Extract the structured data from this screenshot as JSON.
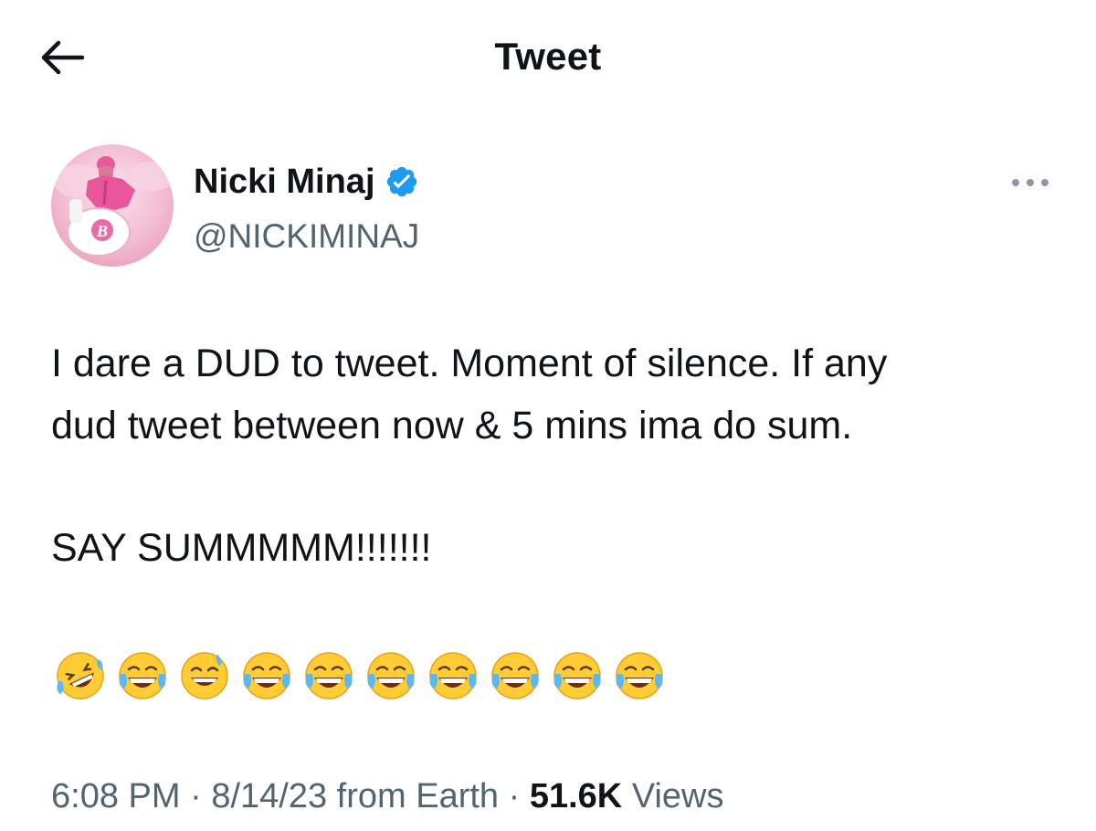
{
  "header": {
    "title": "Tweet"
  },
  "tweet": {
    "author": {
      "display_name": "Nicki Minaj",
      "handle": "@NICKIMINAJ",
      "verified": true
    },
    "text_line_1": "I dare a DUD to tweet. Moment of silence. If any",
    "text_line_2": "dud tweet between now & 5 mins ima do sum.",
    "text_line_3": "SAY SUMMMMM!!!!!!!",
    "emojis": [
      "🤣",
      "😂",
      "😅",
      "😂",
      "😂",
      "😂",
      "😂",
      "😂",
      "😂",
      "😂"
    ],
    "time": "6:08 PM",
    "date": "8/14/23",
    "source": "from Earth",
    "separator": "·",
    "views_count": "51.6K",
    "views_label": "Views"
  },
  "colors": {
    "text_primary": "#0f1419",
    "text_secondary": "#536471",
    "verified_badge": "#1d9bf0",
    "avatar_background": "#f4c6d6"
  },
  "icons": {
    "back": "arrow-left-icon",
    "verified": "verified-badge-icon",
    "more": "more-horizontal-icon"
  }
}
